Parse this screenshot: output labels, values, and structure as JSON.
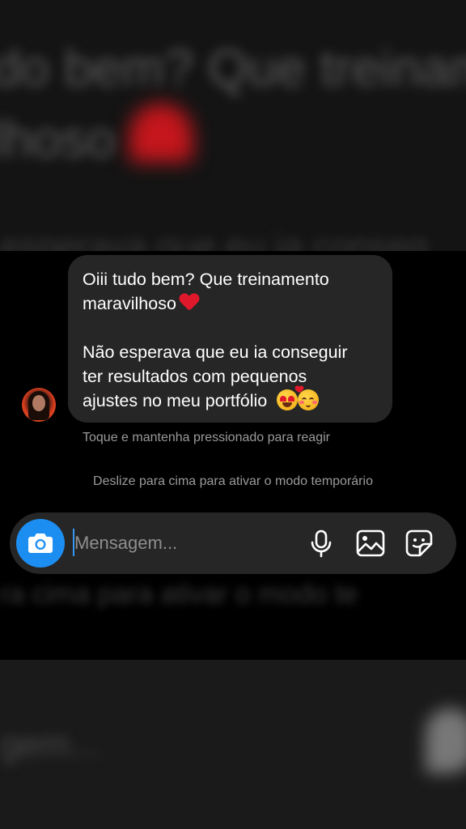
{
  "background": {
    "top_blur_text_1": "do bem? Que treiname",
    "top_blur_text_2": "lhoso",
    "top_blur_text_3": "esperava que eu ia conseg",
    "mid_blur_text": "ra cima para ativar o modo te",
    "bottom_blur_text": "gem..."
  },
  "message": {
    "line1": "Oiii tudo bem? Que treinamento",
    "line2": "maravilhoso",
    "line3": "Não esperava que eu ia conseguir",
    "line4": "ter resultados com pequenos",
    "line5": "ajustes no meu portfólio",
    "heart_icon": "red-heart-icon",
    "emoji_1": "heart-eyes-emoji",
    "emoji_2": "smiling-face-with-hearts-emoji"
  },
  "hints": {
    "react": "Toque e mantenha pressionado para reagir",
    "temporary_mode": "Deslize para cima para ativar o modo temporário"
  },
  "composer": {
    "placeholder": "Mensagem...",
    "value": "",
    "camera_icon": "camera-icon",
    "mic_icon": "microphone-icon",
    "gallery_icon": "gallery-icon",
    "sticker_icon": "sticker-icon",
    "accent_color": "#1d8ef1"
  }
}
